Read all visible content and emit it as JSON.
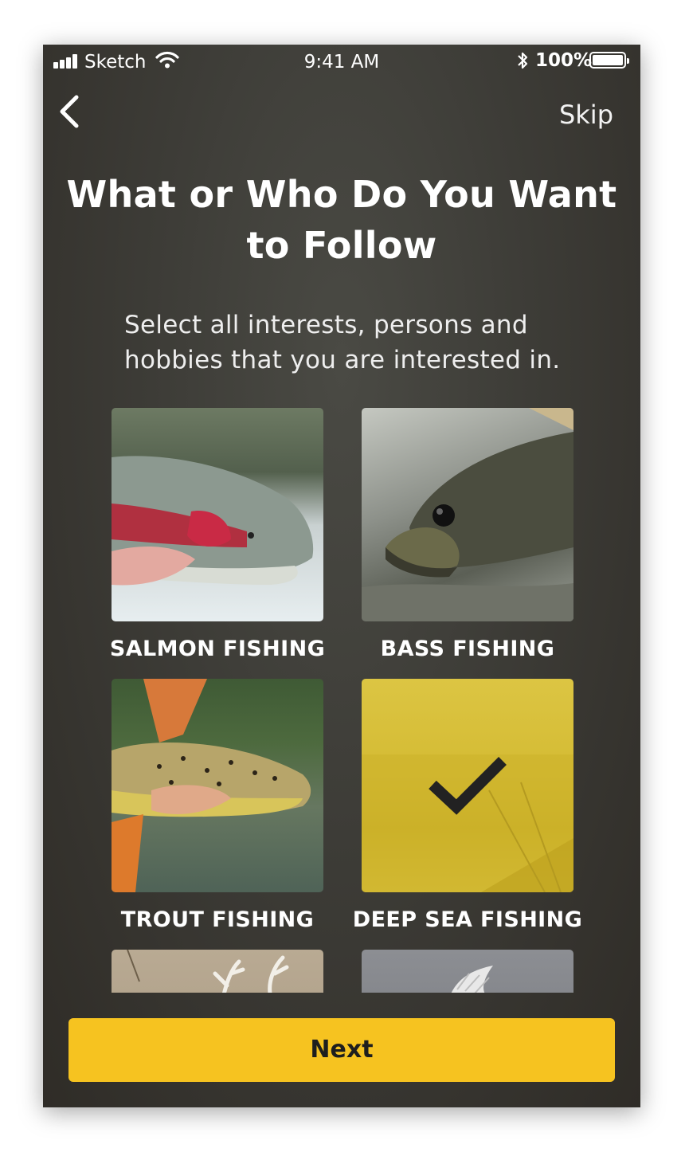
{
  "status_bar": {
    "carrier": "Sketch",
    "time": "9:41 AM",
    "battery": "100%",
    "icons": [
      "signal-icon",
      "wifi-icon",
      "bluetooth-icon",
      "battery-icon"
    ]
  },
  "nav": {
    "back_icon": "chevron-left-icon",
    "skip_label": "Skip"
  },
  "header": {
    "title": "What or Who Do You Want to Follow",
    "subtitle": "Select all interests, persons and hobbies that you are interested in."
  },
  "interests": [
    {
      "label": "SALMON FISHING",
      "selected": false
    },
    {
      "label": "BASS FISHING",
      "selected": false
    },
    {
      "label": "TROUT FISHING",
      "selected": false
    },
    {
      "label": "DEEP SEA FISHING",
      "selected": true,
      "icon": "checkmark-icon"
    },
    {
      "label": "",
      "selected": false
    },
    {
      "label": "",
      "selected": false
    }
  ],
  "footer": {
    "next_label": "Next"
  },
  "colors": {
    "accent": "#F6C320",
    "background": "#3D3C37",
    "selected_overlay": "#D4BB33"
  }
}
